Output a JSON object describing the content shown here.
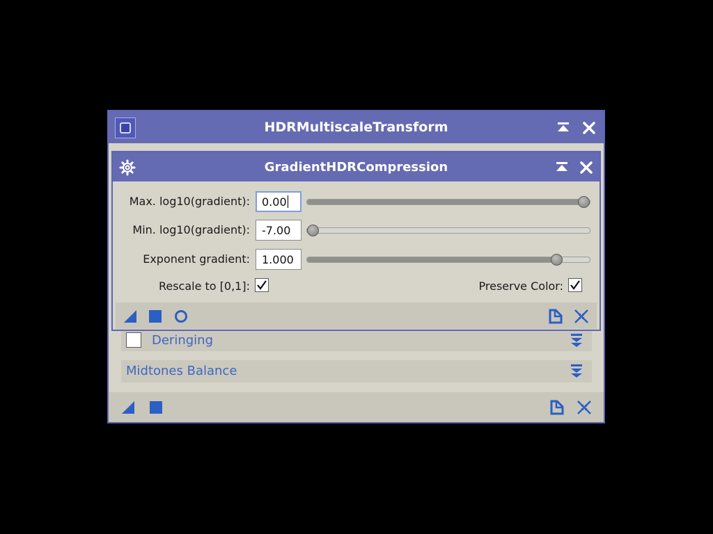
{
  "outer_window": {
    "title": "HDRMultiscaleTransform",
    "icon": "process-window-icon",
    "buttons": [
      "shade-icon",
      "close-icon"
    ]
  },
  "inner_window": {
    "title": "GradientHDRCompression",
    "icon": "gear-icon",
    "buttons": [
      "shade-icon",
      "close-icon"
    ],
    "params": [
      {
        "label": "Max. log10(gradient):",
        "value": "0.00",
        "slider_fraction": 1.0
      },
      {
        "label": "Min. log10(gradient):",
        "value": "-7.00",
        "slider_fraction": 0.0
      },
      {
        "label": "Exponent gradient:",
        "value": "1.000",
        "slider_fraction": 0.9
      }
    ],
    "rescale_label": "Rescale to [0,1]:",
    "rescale_checked": true,
    "preserve_color_label": "Preserve Color:",
    "preserve_color_checked": true,
    "toolbar": {
      "left": [
        "new-instance-icon",
        "apply-square-icon",
        "apply-global-circle-icon"
      ],
      "right": [
        "reset-document-icon",
        "collapse-arrows-icon"
      ]
    }
  },
  "sections": [
    {
      "label": "Deringing",
      "has_checkbox": true,
      "checked": false,
      "icon": "expand-chevrons-icon"
    },
    {
      "label": "Midtones Balance",
      "has_checkbox": false,
      "icon": "expand-chevrons-icon"
    }
  ],
  "outer_toolbar": {
    "left": [
      "new-instance-icon",
      "apply-square-icon"
    ],
    "right": [
      "reset-document-icon",
      "collapse-arrows-icon"
    ]
  },
  "colors": {
    "titlebar": "#646bb2",
    "panel": "#d7d4ca",
    "section_text": "#3d68c0",
    "icon_blue": "#2a5fc4"
  }
}
